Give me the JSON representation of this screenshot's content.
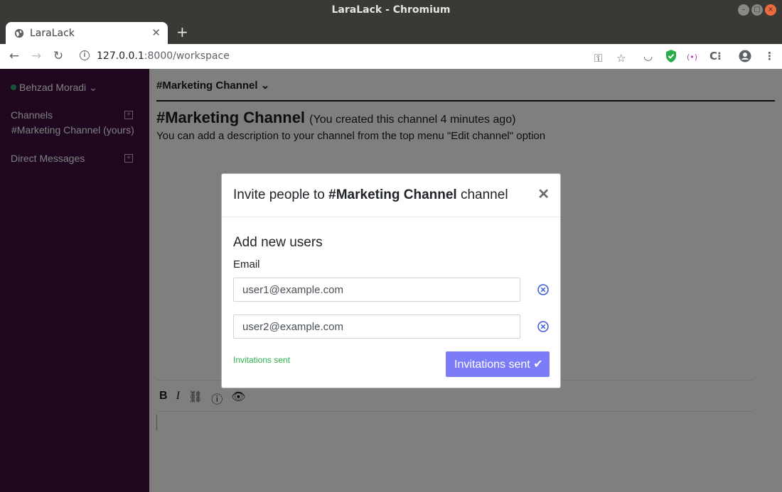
{
  "window": {
    "title": "LaraLack - Chromium"
  },
  "browser": {
    "tab": {
      "label": "LaraLack"
    },
    "url": {
      "host": "127.0.0.1",
      "path": ":8000/workspace"
    }
  },
  "sidebar": {
    "user_name": "Behzad Moradi",
    "channels_label": "Channels",
    "channel_item": "#Marketing Channel (yours)",
    "dm_label": "Direct Messages"
  },
  "main": {
    "channel_header": "#Marketing Channel",
    "channel_title": "#Marketing Channel",
    "channel_subtitle": "(You created this channel 4 minutes ago)",
    "channel_desc": "You can add a description to your channel from the top menu \"Edit channel\" option"
  },
  "modal": {
    "title_prefix": "Invite people to ",
    "title_channel": "#Marketing Channel",
    "title_suffix": " channel",
    "section_title": "Add new users",
    "email_label": "Email",
    "emails": [
      "user1@example.com",
      "user2@example.com"
    ],
    "status": "Invitations sent",
    "submit_label": "Invitations sent"
  },
  "colors": {
    "sidebar": "#3f0e40",
    "accent": "#7c7cf8",
    "success": "#2bb24c",
    "online": "#2bac76"
  }
}
